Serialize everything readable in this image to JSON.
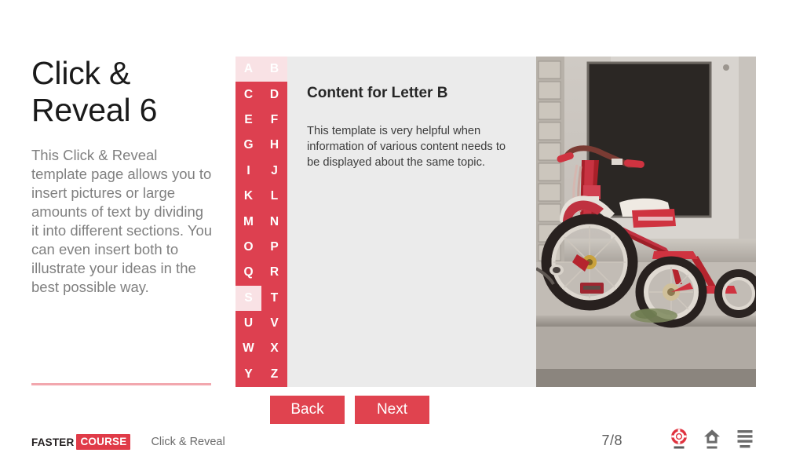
{
  "slide": {
    "title": "Click & Reveal 6",
    "description": "This Click & Reveal template page allows you to insert pictures or large amounts of text by dividing it into different sections. You can even insert both to illustrate your ideas in the best possible way."
  },
  "letter_grid": {
    "letters": [
      "A",
      "B",
      "C",
      "D",
      "E",
      "F",
      "G",
      "H",
      "I",
      "J",
      "K",
      "L",
      "M",
      "N",
      "O",
      "P",
      "Q",
      "R",
      "S",
      "T",
      "U",
      "V",
      "W",
      "X",
      "Y",
      "Z"
    ],
    "active_letters": [
      "A",
      "B",
      "S"
    ],
    "selected_letter": "B",
    "colors": {
      "background": "#dd4050",
      "active_background": "#f9e2e5",
      "text": "#ffffff"
    }
  },
  "content": {
    "heading": "Content for Letter B",
    "body": "This template is very helpful when information of various content needs to be displayed about the same topic."
  },
  "media": {
    "alt": "Vintage red tricycle parked on a concrete step in front of a white door"
  },
  "navigation": {
    "back_label": "Back",
    "next_label": "Next",
    "button_color": "#e0434f"
  },
  "footer": {
    "logo_first": "FASTER",
    "logo_second": "COURSE",
    "label": "Click & Reveal",
    "page_counter": "7/8",
    "icons": [
      {
        "name": "help-lifebuoy-icon",
        "color": "#e0333f"
      },
      {
        "name": "home-icon",
        "color": "#6b6b6b"
      },
      {
        "name": "menu-icon",
        "color": "#6b6b6b"
      }
    ]
  }
}
